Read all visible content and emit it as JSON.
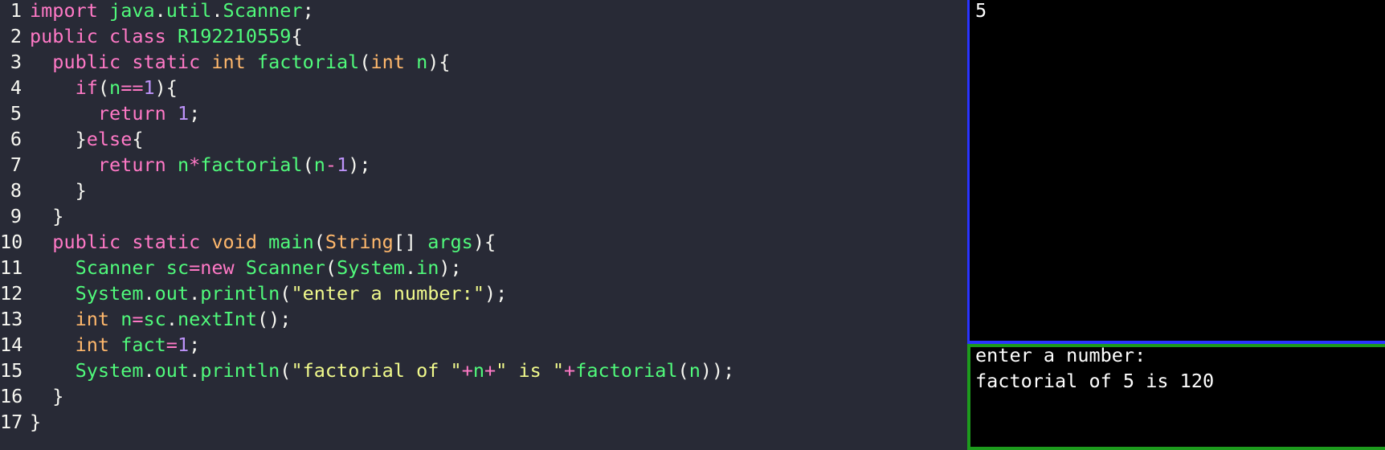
{
  "colors": {
    "background": "#282a36",
    "keyword": "#ff79c6",
    "type": "#ffb86c",
    "function": "#50fa7b",
    "string": "#f1fa8c",
    "number": "#bd93f9",
    "plain": "#f8f8f2",
    "stdin_border": "#2a34ff",
    "stdout_border": "#1d9a1d"
  },
  "editor": {
    "lines": [
      {
        "n": "1",
        "tokens": [
          {
            "t": "import",
            "c": "keyword"
          },
          {
            "t": " ",
            "c": "plain"
          },
          {
            "t": "java",
            "c": "function"
          },
          {
            "t": ".",
            "c": "plain"
          },
          {
            "t": "util",
            "c": "function"
          },
          {
            "t": ".",
            "c": "plain"
          },
          {
            "t": "Scanner",
            "c": "function"
          },
          {
            "t": ";",
            "c": "plain"
          }
        ]
      },
      {
        "n": "2",
        "tokens": [
          {
            "t": "public",
            "c": "keyword"
          },
          {
            "t": " ",
            "c": "plain"
          },
          {
            "t": "class",
            "c": "keyword"
          },
          {
            "t": " ",
            "c": "plain"
          },
          {
            "t": "R192210559",
            "c": "function"
          },
          {
            "t": "{",
            "c": "plain"
          }
        ]
      },
      {
        "n": "3",
        "tokens": [
          {
            "t": "  ",
            "c": "plain"
          },
          {
            "t": "public",
            "c": "keyword"
          },
          {
            "t": " ",
            "c": "plain"
          },
          {
            "t": "static",
            "c": "keyword"
          },
          {
            "t": " ",
            "c": "plain"
          },
          {
            "t": "int",
            "c": "type"
          },
          {
            "t": " ",
            "c": "plain"
          },
          {
            "t": "factorial",
            "c": "function"
          },
          {
            "t": "(",
            "c": "plain"
          },
          {
            "t": "int",
            "c": "type"
          },
          {
            "t": " ",
            "c": "plain"
          },
          {
            "t": "n",
            "c": "function"
          },
          {
            "t": "){",
            "c": "plain"
          }
        ]
      },
      {
        "n": "4",
        "tokens": [
          {
            "t": "    ",
            "c": "plain"
          },
          {
            "t": "if",
            "c": "keyword"
          },
          {
            "t": "(",
            "c": "plain"
          },
          {
            "t": "n",
            "c": "function"
          },
          {
            "t": "==",
            "c": "keyword"
          },
          {
            "t": "1",
            "c": "number"
          },
          {
            "t": "){",
            "c": "plain"
          }
        ]
      },
      {
        "n": "5",
        "tokens": [
          {
            "t": "      ",
            "c": "plain"
          },
          {
            "t": "return",
            "c": "keyword"
          },
          {
            "t": " ",
            "c": "plain"
          },
          {
            "t": "1",
            "c": "number"
          },
          {
            "t": ";",
            "c": "plain"
          }
        ]
      },
      {
        "n": "6",
        "tokens": [
          {
            "t": "    }",
            "c": "plain"
          },
          {
            "t": "else",
            "c": "keyword"
          },
          {
            "t": "{",
            "c": "plain"
          }
        ]
      },
      {
        "n": "7",
        "tokens": [
          {
            "t": "      ",
            "c": "plain"
          },
          {
            "t": "return",
            "c": "keyword"
          },
          {
            "t": " ",
            "c": "plain"
          },
          {
            "t": "n",
            "c": "function"
          },
          {
            "t": "*",
            "c": "keyword"
          },
          {
            "t": "factorial",
            "c": "function"
          },
          {
            "t": "(",
            "c": "plain"
          },
          {
            "t": "n",
            "c": "function"
          },
          {
            "t": "-",
            "c": "keyword"
          },
          {
            "t": "1",
            "c": "number"
          },
          {
            "t": ");",
            "c": "plain"
          }
        ]
      },
      {
        "n": "8",
        "tokens": [
          {
            "t": "    }",
            "c": "plain"
          }
        ]
      },
      {
        "n": "9",
        "tokens": [
          {
            "t": "  }",
            "c": "plain"
          }
        ]
      },
      {
        "n": "10",
        "tokens": [
          {
            "t": "  ",
            "c": "plain"
          },
          {
            "t": "public",
            "c": "keyword"
          },
          {
            "t": " ",
            "c": "plain"
          },
          {
            "t": "static",
            "c": "keyword"
          },
          {
            "t": " ",
            "c": "plain"
          },
          {
            "t": "void",
            "c": "type"
          },
          {
            "t": " ",
            "c": "plain"
          },
          {
            "t": "main",
            "c": "function"
          },
          {
            "t": "(",
            "c": "plain"
          },
          {
            "t": "String",
            "c": "type"
          },
          {
            "t": "[] ",
            "c": "plain"
          },
          {
            "t": "args",
            "c": "function"
          },
          {
            "t": "){",
            "c": "plain"
          }
        ]
      },
      {
        "n": "11",
        "tokens": [
          {
            "t": "    ",
            "c": "plain"
          },
          {
            "t": "Scanner",
            "c": "function"
          },
          {
            "t": " ",
            "c": "plain"
          },
          {
            "t": "sc",
            "c": "function"
          },
          {
            "t": "=",
            "c": "keyword"
          },
          {
            "t": "new",
            "c": "keyword"
          },
          {
            "t": " ",
            "c": "plain"
          },
          {
            "t": "Scanner",
            "c": "function"
          },
          {
            "t": "(",
            "c": "plain"
          },
          {
            "t": "System",
            "c": "function"
          },
          {
            "t": ".",
            "c": "plain"
          },
          {
            "t": "in",
            "c": "function"
          },
          {
            "t": ");",
            "c": "plain"
          }
        ]
      },
      {
        "n": "12",
        "tokens": [
          {
            "t": "    ",
            "c": "plain"
          },
          {
            "t": "System",
            "c": "function"
          },
          {
            "t": ".",
            "c": "plain"
          },
          {
            "t": "out",
            "c": "function"
          },
          {
            "t": ".",
            "c": "plain"
          },
          {
            "t": "println",
            "c": "function"
          },
          {
            "t": "(",
            "c": "plain"
          },
          {
            "t": "\"enter a number:\"",
            "c": "string"
          },
          {
            "t": ");",
            "c": "plain"
          }
        ]
      },
      {
        "n": "13",
        "tokens": [
          {
            "t": "    ",
            "c": "plain"
          },
          {
            "t": "int",
            "c": "type"
          },
          {
            "t": " ",
            "c": "plain"
          },
          {
            "t": "n",
            "c": "function"
          },
          {
            "t": "=",
            "c": "keyword"
          },
          {
            "t": "sc",
            "c": "function"
          },
          {
            "t": ".",
            "c": "plain"
          },
          {
            "t": "nextInt",
            "c": "function"
          },
          {
            "t": "();",
            "c": "plain"
          }
        ]
      },
      {
        "n": "14",
        "tokens": [
          {
            "t": "    ",
            "c": "plain"
          },
          {
            "t": "int",
            "c": "type"
          },
          {
            "t": " ",
            "c": "plain"
          },
          {
            "t": "fact",
            "c": "function"
          },
          {
            "t": "=",
            "c": "keyword"
          },
          {
            "t": "1",
            "c": "number"
          },
          {
            "t": ";",
            "c": "plain"
          }
        ]
      },
      {
        "n": "15",
        "tokens": [
          {
            "t": "    ",
            "c": "plain"
          },
          {
            "t": "System",
            "c": "function"
          },
          {
            "t": ".",
            "c": "plain"
          },
          {
            "t": "out",
            "c": "function"
          },
          {
            "t": ".",
            "c": "plain"
          },
          {
            "t": "println",
            "c": "function"
          },
          {
            "t": "(",
            "c": "plain"
          },
          {
            "t": "\"factorial of \"",
            "c": "string"
          },
          {
            "t": "+",
            "c": "keyword"
          },
          {
            "t": "n",
            "c": "function"
          },
          {
            "t": "+",
            "c": "keyword"
          },
          {
            "t": "\" is \"",
            "c": "string"
          },
          {
            "t": "+",
            "c": "keyword"
          },
          {
            "t": "factorial",
            "c": "function"
          },
          {
            "t": "(",
            "c": "plain"
          },
          {
            "t": "n",
            "c": "function"
          },
          {
            "t": "));",
            "c": "plain"
          }
        ]
      },
      {
        "n": "16",
        "tokens": [
          {
            "t": "  }",
            "c": "plain"
          }
        ]
      },
      {
        "n": "17",
        "tokens": [
          {
            "t": "}",
            "c": "plain"
          }
        ]
      }
    ]
  },
  "stdin": {
    "value": "5"
  },
  "stdout": {
    "line1": "enter a number:",
    "line2": "factorial of 5 is 120"
  }
}
